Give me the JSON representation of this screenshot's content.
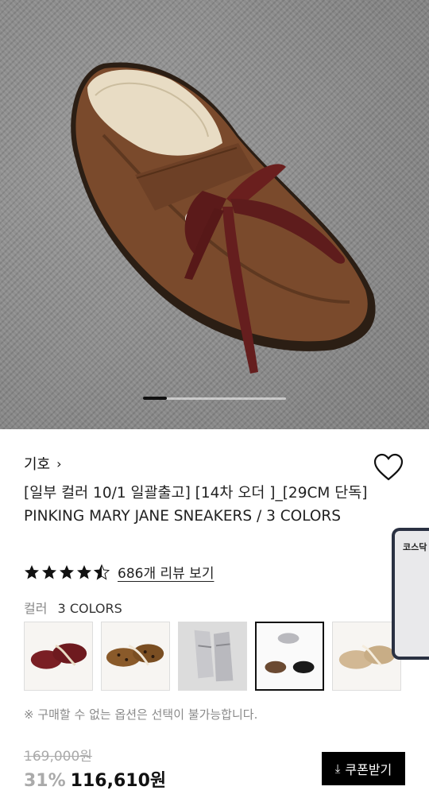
{
  "brand": {
    "name": "기호",
    "chevron": "›"
  },
  "product": {
    "title": "[일부 컬러 10/1 일괄출고] [14차 오더 ]_[29CM 단독] PINKING MARY JANE SNEAKERS / 3 COLORS",
    "rating": 4.5,
    "review_text": "686개 리뷰 보기"
  },
  "color": {
    "label": "컬러",
    "value": "3 COLORS"
  },
  "swatches": [
    {
      "name": "burgundy",
      "color": "#7a1f24"
    },
    {
      "name": "leopard",
      "color": "#8a5a2a"
    },
    {
      "name": "silver",
      "color": "#c8c8cc"
    },
    {
      "name": "all-colors",
      "color": "#6b4a32"
    },
    {
      "name": "beige",
      "color": "#d2b894"
    }
  ],
  "selected_swatch_index": 3,
  "side_card": {
    "label": "코스닥"
  },
  "notice": "※ 구매할 수 없는 옵션은 선택이 불가능합니다.",
  "price": {
    "original": "169,000원",
    "discount": "31%",
    "sale": "116,610원"
  },
  "coupon": {
    "label": "쿠폰받기",
    "icon": "download-icon"
  },
  "colors": {
    "accent": "#000000",
    "muted": "#aaaaaa"
  }
}
